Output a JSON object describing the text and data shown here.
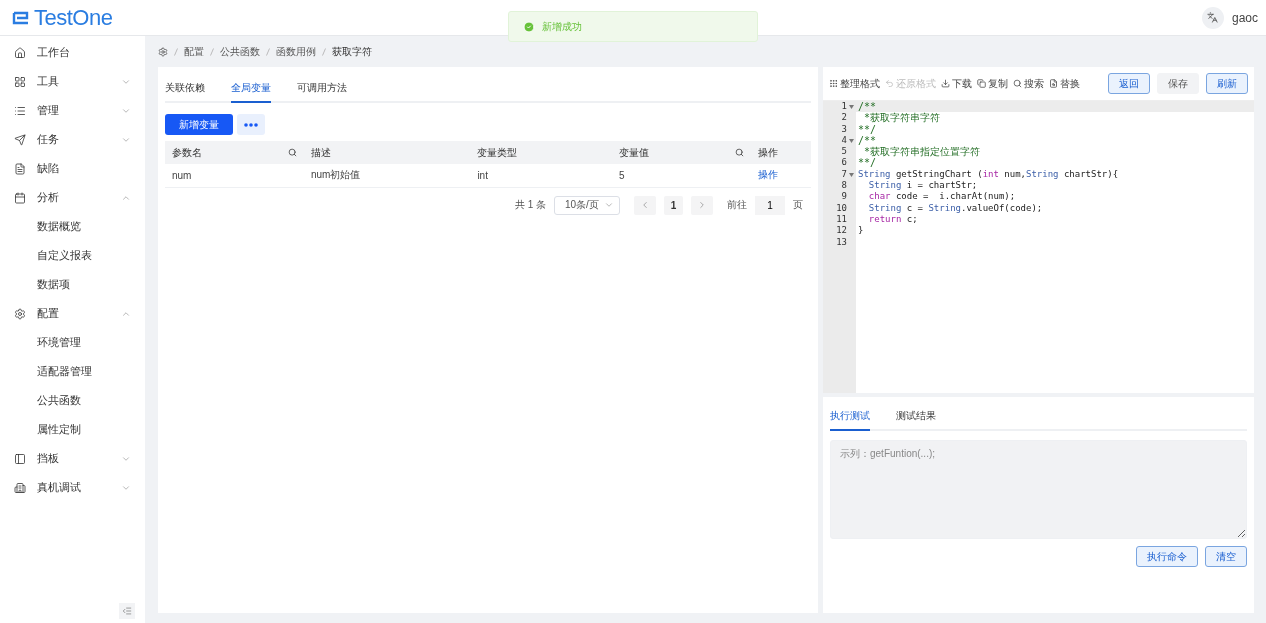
{
  "header": {
    "logo": "TestOne",
    "user": "gaoc"
  },
  "toast": {
    "kind": "success",
    "message": "新增成功"
  },
  "sidebar": {
    "items": [
      {
        "label": "工作台",
        "kind": "link"
      },
      {
        "label": "工具",
        "kind": "group",
        "expanded": false
      },
      {
        "label": "管理",
        "kind": "group",
        "expanded": false
      },
      {
        "label": "任务",
        "kind": "group",
        "expanded": false
      },
      {
        "label": "缺陷",
        "kind": "link"
      },
      {
        "label": "分析",
        "kind": "group",
        "expanded": true,
        "children": [
          {
            "label": "数据概览"
          },
          {
            "label": "自定义报表"
          },
          {
            "label": "数据项"
          }
        ]
      },
      {
        "label": "配置",
        "kind": "group",
        "expanded": true,
        "children": [
          {
            "label": "环境管理"
          },
          {
            "label": "适配器管理"
          },
          {
            "label": "公共函数"
          },
          {
            "label": "属性定制"
          }
        ]
      },
      {
        "label": "挡板",
        "kind": "group",
        "expanded": false
      },
      {
        "label": "真机调试",
        "kind": "group",
        "expanded": false
      }
    ]
  },
  "breadcrumb": [
    "配置",
    "公共函数",
    "函数用例",
    "获取字符"
  ],
  "tabs": [
    {
      "label": "关联依赖",
      "selected": false
    },
    {
      "label": "全局变量",
      "selected": true
    },
    {
      "label": "可调用方法",
      "selected": false
    }
  ],
  "add_button": "新增变量",
  "table": {
    "columns": [
      {
        "label": "参数名",
        "filterable": true
      },
      {
        "label": "描述",
        "filterable": false
      },
      {
        "label": "变量类型",
        "filterable": false
      },
      {
        "label": "变量值",
        "filterable": true
      },
      {
        "label": "操作",
        "filterable": false
      }
    ],
    "rows": [
      {
        "cells": [
          "num",
          "num初始值",
          "int",
          "5"
        ],
        "action": "操作"
      }
    ]
  },
  "pagination": {
    "total": "共 1 条",
    "page_size": "10条/页",
    "pages": [
      {
        "label": "1",
        "selected": true
      }
    ],
    "goto_label": "前往",
    "goto_value": "1",
    "goto_suffix": "页"
  },
  "editor_toolbar": [
    {
      "label": "整理格式",
      "disabled": false
    },
    {
      "label": "还原格式",
      "disabled": true
    },
    {
      "label": "下载",
      "disabled": false
    },
    {
      "label": "复制",
      "disabled": false
    },
    {
      "label": "搜索",
      "disabled": false
    },
    {
      "label": "替换",
      "disabled": false
    }
  ],
  "editor_buttons": [
    {
      "label": "返回",
      "kind": "outline"
    },
    {
      "label": "保存",
      "kind": "plain"
    },
    {
      "label": "刷新",
      "kind": "outline"
    }
  ],
  "code": [
    {
      "number": "1",
      "foldable": true,
      "tokens": [
        {
          "kind": "comment",
          "text": "/**"
        }
      ]
    },
    {
      "number": "2",
      "foldable": false,
      "tokens": [
        {
          "kind": "comment",
          "text": " *获取字符串字符"
        }
      ]
    },
    {
      "number": "3",
      "foldable": false,
      "tokens": [
        {
          "kind": "comment",
          "text": "**/"
        }
      ]
    },
    {
      "number": "4",
      "foldable": true,
      "tokens": [
        {
          "kind": "comment",
          "text": "/**"
        }
      ]
    },
    {
      "number": "5",
      "foldable": false,
      "tokens": [
        {
          "kind": "comment",
          "text": " *获取字符串指定位置字符"
        }
      ]
    },
    {
      "number": "6",
      "foldable": false,
      "tokens": [
        {
          "kind": "comment",
          "text": "**/"
        }
      ]
    },
    {
      "number": "7",
      "foldable": true,
      "tokens": [
        {
          "kind": "type",
          "text": "String"
        },
        {
          "kind": "plain",
          "text": " getStringChart ("
        },
        {
          "kind": "keyword",
          "text": "int"
        },
        {
          "kind": "plain",
          "text": " num,"
        },
        {
          "kind": "type",
          "text": "String"
        },
        {
          "kind": "plain",
          "text": " chartStr){"
        }
      ]
    },
    {
      "number": "8",
      "foldable": false,
      "tokens": [
        {
          "kind": "type",
          "text": "  String"
        },
        {
          "kind": "plain",
          "text": " i = chartStr;"
        }
      ]
    },
    {
      "number": "9",
      "foldable": false,
      "tokens": [
        {
          "kind": "keyword",
          "text": "  char"
        },
        {
          "kind": "plain",
          "text": " code =  i.charAt(num);"
        }
      ]
    },
    {
      "number": "10",
      "foldable": false,
      "tokens": [
        {
          "kind": "type",
          "text": "  String"
        },
        {
          "kind": "plain",
          "text": " c = "
        },
        {
          "kind": "type",
          "text": "String"
        },
        {
          "kind": "plain",
          "text": ".valueOf(code);"
        }
      ]
    },
    {
      "number": "11",
      "foldable": false,
      "tokens": [
        {
          "kind": "keyword",
          "text": "  return"
        },
        {
          "kind": "plain",
          "text": " c;"
        }
      ]
    },
    {
      "number": "12",
      "foldable": false,
      "tokens": [
        {
          "kind": "plain",
          "text": "}"
        }
      ]
    },
    {
      "number": "13",
      "foldable": false
    }
  ],
  "test_tabs": [
    {
      "label": "执行测试",
      "selected": true
    },
    {
      "label": "测试结果",
      "selected": false
    }
  ],
  "test_input": {
    "placeholder": "示列：getFuntion(...);"
  },
  "test_buttons": [
    {
      "label": "执行命令",
      "kind": "outline"
    },
    {
      "label": "清空",
      "kind": "outline"
    }
  ]
}
